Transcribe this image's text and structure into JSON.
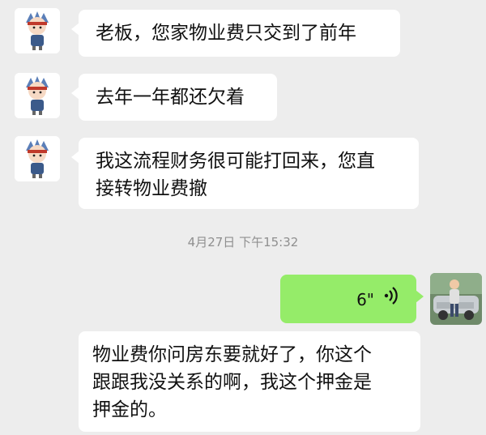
{
  "messages": [
    {
      "sender": "other",
      "text": "老板，您家物业费只交到了前年"
    },
    {
      "sender": "other",
      "text": "去年一年都还欠着"
    },
    {
      "sender": "other",
      "text_line1": "我这流程财务很可能打回来，您直",
      "text_line2": "接转物业费撤"
    },
    {
      "sender": "self",
      "type": "voice",
      "duration": "6\"",
      "icon": "voice-wave-icon"
    },
    {
      "sender": "other",
      "text_line1": "物业费你问房东要就好了，你这个",
      "text_line2": "跟跟我没关系的啊，我这个押金是",
      "text_line3": "押金的。"
    }
  ],
  "timestamp": "4月27日 下午15:32",
  "colors": {
    "background": "#ededed",
    "bubble_in": "#ffffff",
    "bubble_out": "#95ec69",
    "timestamp_text": "#8f8f8f"
  }
}
